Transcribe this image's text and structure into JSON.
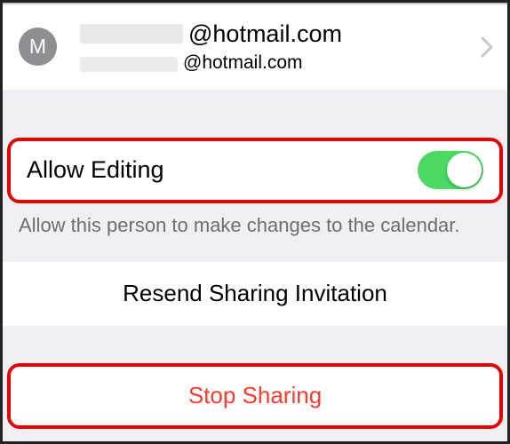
{
  "contact": {
    "avatar_initial": "M",
    "primary_email_suffix": "@hotmail.com",
    "secondary_email_suffix": "@hotmail.com"
  },
  "allow_editing": {
    "label": "Allow Editing",
    "enabled": true,
    "description": "Allow this person to make changes to the calendar."
  },
  "actions": {
    "resend_label": "Resend Sharing Invitation",
    "stop_label": "Stop Sharing"
  }
}
